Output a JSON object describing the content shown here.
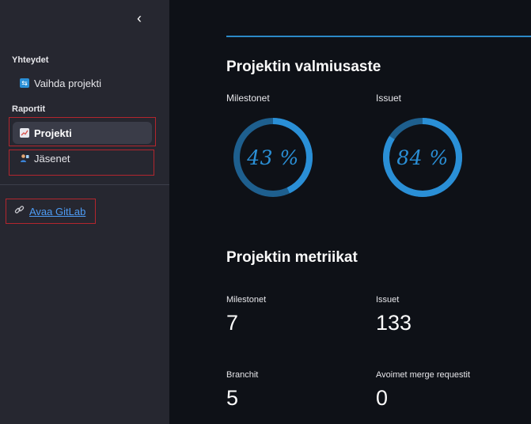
{
  "sidebar": {
    "collapse_icon": "chevron-left-icon",
    "sections": {
      "connections": "Yhteydet",
      "reports": "Raportit"
    },
    "items": [
      {
        "label": "Vaihda projekti",
        "icon": "swap-icon"
      },
      {
        "label": "Projekti",
        "icon": "chart-icon",
        "active": true
      },
      {
        "label": "Jäsenet",
        "icon": "person-icon"
      }
    ],
    "external_link": {
      "label": "Avaa GitLab",
      "icon": "link-icon"
    }
  },
  "main": {
    "completion": {
      "title": "Projektin valmiusaste",
      "gauges": [
        {
          "label": "Milestonet",
          "value_text": "43 %",
          "fraction": 0.43
        },
        {
          "label": "Issuet",
          "value_text": "84 %",
          "fraction": 0.84
        }
      ]
    },
    "metrics": {
      "title": "Projektin metriikat",
      "items": [
        {
          "label": "Milestonet",
          "value": "7"
        },
        {
          "label": "Issuet",
          "value": "133"
        },
        {
          "label": "Branchit",
          "value": "5"
        },
        {
          "label": "Avoimet merge requestit",
          "value": "0"
        }
      ]
    }
  },
  "colors": {
    "accent": "#2a8fd6",
    "gauge_track": "#1e5f8e",
    "highlight_box": "#b3262e",
    "sidebar_bg": "#262730",
    "main_bg": "#0e1117",
    "link": "#4e9cf5"
  }
}
